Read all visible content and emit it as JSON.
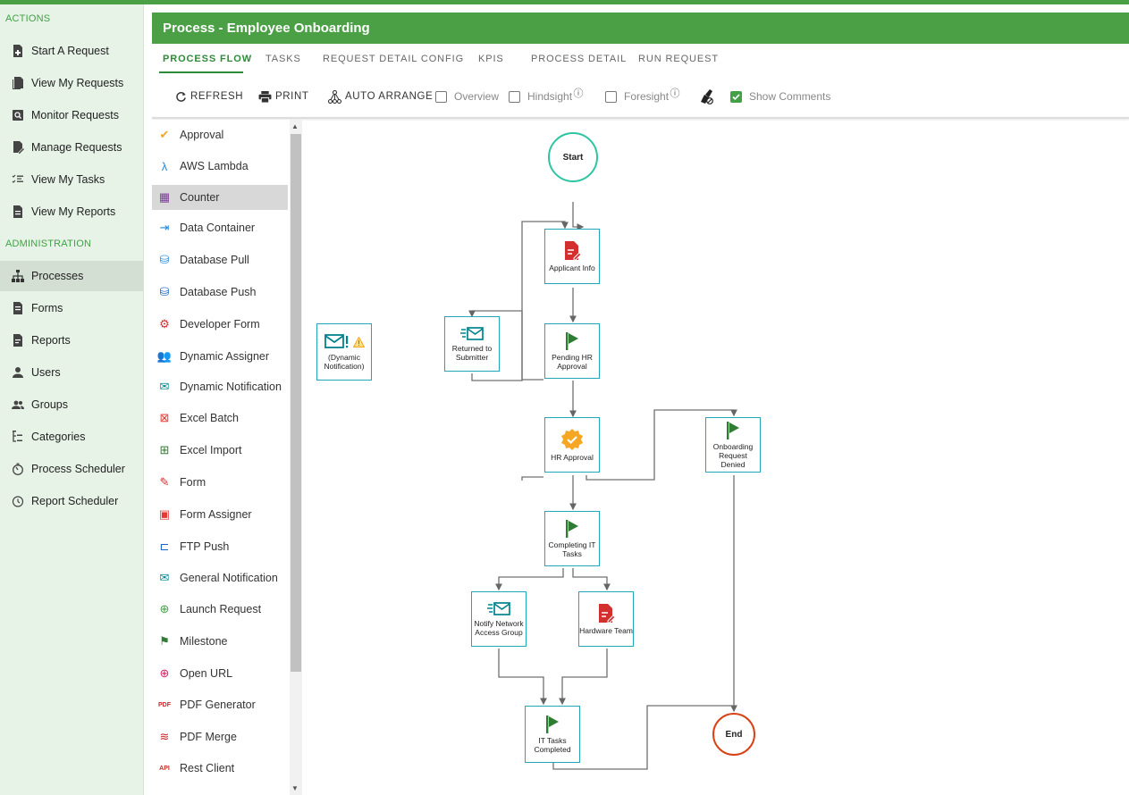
{
  "nav": {
    "actions_label": "ACTIONS",
    "actions": [
      {
        "label": "Start A Request",
        "icon": "add-document-icon"
      },
      {
        "label": "View My Requests",
        "icon": "documents-icon"
      },
      {
        "label": "Monitor Requests",
        "icon": "monitor-search-icon"
      },
      {
        "label": "Manage Requests",
        "icon": "edit-document-icon"
      },
      {
        "label": "View My Tasks",
        "icon": "task-list-icon"
      },
      {
        "label": "View My Reports",
        "icon": "report-icon"
      }
    ],
    "admin_label": "ADMINISTRATION",
    "admin": [
      {
        "label": "Processes",
        "icon": "org-chart-icon"
      },
      {
        "label": "Forms",
        "icon": "form-icon"
      },
      {
        "label": "Reports",
        "icon": "report-icon"
      },
      {
        "label": "Users",
        "icon": "user-icon"
      },
      {
        "label": "Groups",
        "icon": "group-icon"
      },
      {
        "label": "Categories",
        "icon": "categories-icon"
      },
      {
        "label": "Process Scheduler",
        "icon": "timer-icon"
      },
      {
        "label": "Report Scheduler",
        "icon": "timer-icon"
      }
    ]
  },
  "header": {
    "title": "Process - Employee Onboarding"
  },
  "tabs": [
    "PROCESS FLOW",
    "TASKS",
    "REQUEST DETAIL CONFIG",
    "KPIS",
    "PROCESS DETAIL",
    "RUN REQUEST"
  ],
  "toolbar": {
    "refresh": "REFRESH",
    "print": "PRINT",
    "auto_arrange": "AUTO ARRANGE",
    "overview": "Overview",
    "hindsight": "Hindsight",
    "foresight": "Foresight",
    "show_comments": "Show Comments",
    "info_glyph": "ⓘ"
  },
  "palette": [
    {
      "label": "Approval",
      "icon": "approval-badge-icon",
      "glyph": "✔",
      "color": "#f5a623"
    },
    {
      "label": "AWS Lambda",
      "icon": "lambda-icon",
      "glyph": "λ",
      "color": "#1e88e5"
    },
    {
      "label": "Counter",
      "icon": "counter-icon",
      "glyph": "▦",
      "color": "#7b3f98"
    },
    {
      "label": "Data Container",
      "icon": "data-container-icon",
      "glyph": "⇥",
      "color": "#1e88e5"
    },
    {
      "label": "Database Pull",
      "icon": "database-pull-icon",
      "glyph": "⛁",
      "color": "#1e88e5"
    },
    {
      "label": "Database Push",
      "icon": "database-push-icon",
      "glyph": "⛁",
      "color": "#1565c0"
    },
    {
      "label": "Developer Form",
      "icon": "developer-form-icon",
      "glyph": "⚙",
      "color": "#d32f2f"
    },
    {
      "label": "Dynamic Assigner",
      "icon": "dynamic-assigner-icon",
      "glyph": "👥",
      "color": "#26a69a"
    },
    {
      "label": "Dynamic Notification",
      "icon": "dynamic-notification-icon",
      "glyph": "✉",
      "color": "#00838f"
    },
    {
      "label": "Excel Batch",
      "icon": "excel-batch-icon",
      "glyph": "⊠",
      "color": "#e53935"
    },
    {
      "label": "Excel Import",
      "icon": "excel-import-icon",
      "glyph": "⊞",
      "color": "#2e7d32"
    },
    {
      "label": "Form",
      "icon": "form-icon",
      "glyph": "✎",
      "color": "#d32f2f"
    },
    {
      "label": "Form Assigner",
      "icon": "form-assigner-icon",
      "glyph": "▣",
      "color": "#e53935"
    },
    {
      "label": "FTP Push",
      "icon": "ftp-push-icon",
      "glyph": "⊏",
      "color": "#1565c0"
    },
    {
      "label": "General Notification",
      "icon": "general-notification-icon",
      "glyph": "✉",
      "color": "#00838f"
    },
    {
      "label": "Launch Request",
      "icon": "launch-request-icon",
      "glyph": "⊕",
      "color": "#43a047"
    },
    {
      "label": "Milestone",
      "icon": "milestone-flag-icon",
      "glyph": "⚑",
      "color": "#2e7d32"
    },
    {
      "label": "Open URL",
      "icon": "globe-icon",
      "glyph": "⊕",
      "color": "#d81b60"
    },
    {
      "label": "PDF Generator",
      "icon": "pdf-icon",
      "glyph": "PDF",
      "color": "#c62828"
    },
    {
      "label": "PDF Merge",
      "icon": "pdf-merge-icon",
      "glyph": "≋",
      "color": "#c62828"
    },
    {
      "label": "Rest Client",
      "icon": "api-icon",
      "glyph": "API",
      "color": "#c62828"
    }
  ],
  "flow": {
    "start": "Start",
    "end": "End",
    "nodes": {
      "applicant_info": "Applicant Info",
      "returned_to_submitter": "Returned to Submitter",
      "pending_hr_approval": "Pending HR Approval",
      "dynamic_notification": "(Dynamic Notification)",
      "hr_approval": "HR Approval",
      "onboarding_denied": "Onboarding Request Denied",
      "completing_it_tasks": "Completing IT Tasks",
      "notify_network": "Notify Network Access Group",
      "hardware_team": "Hardware Team",
      "it_tasks_completed": "IT Tasks Completed"
    }
  },
  "colors": {
    "brand_green": "#4ba046",
    "node_border": "#22a6b8",
    "start_ring": "#2ec4a4",
    "end_ring": "#d84315",
    "form_red": "#d32f2f",
    "milestone_green": "#2e7d32",
    "approval_orange": "#f5a623"
  }
}
